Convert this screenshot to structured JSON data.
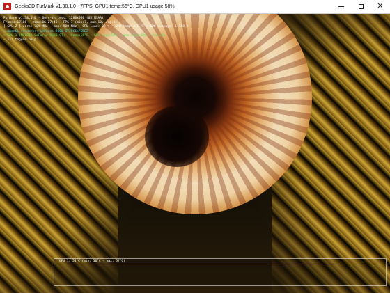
{
  "window": {
    "title": "Geeks3D FurMark v1.38.1.0 - 7FPS, GPU1 temp:56°C, GPU1 usage:58%",
    "controls": {
      "minimize": "—",
      "maximize": "☐",
      "close": "✕"
    },
    "icon": "furmark-app-icon"
  },
  "overlay": {
    "lines": [
      {
        "text": "FurMark v1.38.1.0 - Burn-in test, 1280x960 (0X MSAA)",
        "color": "#ffffff"
      },
      {
        "text": "Frames:17186 - time:06:27:46 - FPS:7 (min:7, max:10, avg:8)",
        "color": "#ffffff"
      },
      {
        "text": "[ GPU-Z ] core: 709 MHz - mem: 900 MHz - GPU load: 98 % - GPU temp: 61 °C - GPU voltage: 1.188 V",
        "color": "#ffffff"
      },
      {
        "text": "> OpenGL renderer: GeForce 9600 GT/PCIe/SSE2",
        "color": "#49d8e8"
      },
      {
        "text": "> GPU 1 (NVIDIA GeForce 9600 GT) - temp:56°C - GPU load:58% - mem load:40% - fan:35%",
        "color": "#5fe05f"
      },
      {
        "text": "- F1: toggle help",
        "color": "#ffffff"
      }
    ]
  },
  "graph": {
    "label": "GPU 1: 56°C (min: 36°C - max: 57°C)"
  }
}
